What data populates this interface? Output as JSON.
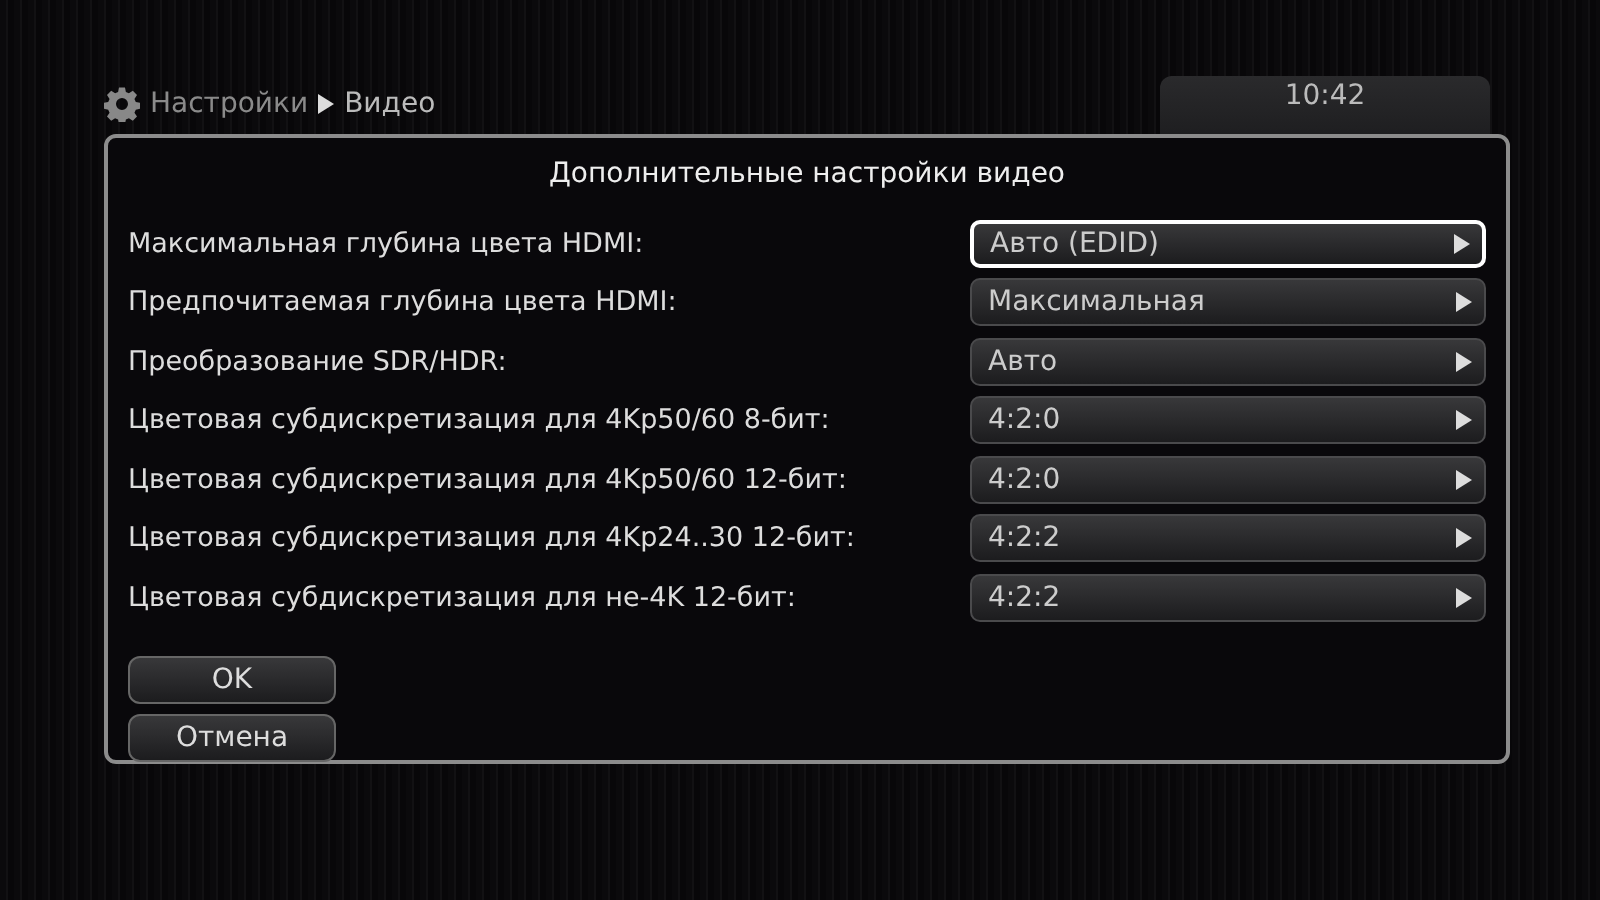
{
  "breadcrumb": [
    "Настройки",
    "Видео"
  ],
  "clock": "10:42",
  "dialog": {
    "title": "Дополнительные настройки видео",
    "settings": [
      {
        "label": "Максимальная глубина цвета HDMI:",
        "value": "Авто (EDID)",
        "selected": true
      },
      {
        "label": "Предпочитаемая глубина цвета HDMI:",
        "value": "Максимальная",
        "selected": false
      },
      {
        "label": "Преобразование SDR/HDR:",
        "value": "Авто",
        "selected": false
      },
      {
        "label": "Цветовая субдискретизация для 4Kp50/60 8-бит:",
        "value": "4:2:0",
        "selected": false
      },
      {
        "label": "Цветовая субдискретизация для 4Kp50/60 12-бит:",
        "value": "4:2:0",
        "selected": false
      },
      {
        "label": "Цветовая субдискретизация для 4Kp24..30 12-бит:",
        "value": "4:2:2",
        "selected": false
      },
      {
        "label": "Цветовая субдискретизация для не-4K 12-бит:",
        "value": "4:2:2",
        "selected": false
      }
    ],
    "buttons": [
      "OK",
      "Отмена"
    ]
  }
}
